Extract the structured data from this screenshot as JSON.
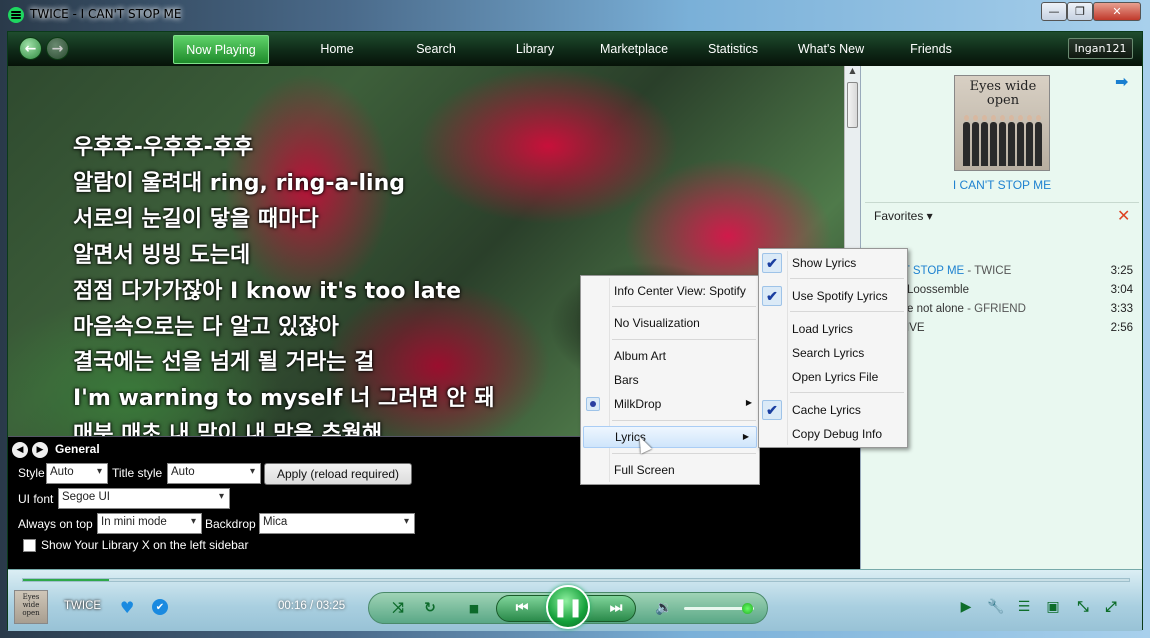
{
  "window": {
    "title": "TWICE - I CAN'T STOP ME",
    "min": "—",
    "max": "❐",
    "close": "✕"
  },
  "nav": {
    "back": "←",
    "forward": "→",
    "tabs": [
      "Now Playing",
      "Home",
      "Search",
      "Library",
      "Marketplace",
      "Statistics",
      "What's New",
      "Friends"
    ],
    "user": "Ingan121"
  },
  "lyrics": [
    "우후후-우후후-후후",
    "알람이 울려대 ring, ring-a-ling",
    "서로의 눈길이 닿을 때마다",
    "알면서 빙빙 도는데",
    "점점 다가가잖아 I know it's too late",
    "마음속으로는 다 알고 있잖아",
    "결국에는 선을 넘게 될 거라는 걸",
    "I'm warning to myself 너 그러면 안 돼",
    "매분 매초 내 맘이 내 맘을 추월해"
  ],
  "right_pane": {
    "album_art_text": "Eyes wide open",
    "next_icon": "➡",
    "track_title": "I CAN'T STOP ME",
    "favorites_label": "Favorites ▾",
    "clear_icon": "✕",
    "favorites": [
      {
        "title": "I CAN'T STOP ME",
        "artist": " - TWICE",
        "duration": "3:25",
        "active": true
      },
      {
        "title": "Loossemble",
        "artist": "",
        "duration": "3:04",
        "active": false
      },
      {
        "title": "e not alone",
        "artist": " - GFRIEND",
        "duration": "3:33",
        "active": false
      },
      {
        "title": "- IVE",
        "artist": "",
        "duration": "2:56",
        "active": false
      }
    ]
  },
  "settings": {
    "prev": "◀",
    "next": "▶",
    "section": "General",
    "style_label": "Style",
    "style_value": "Auto",
    "title_style_label": "Title style",
    "title_style_value": "Auto",
    "apply_label": "Apply (reload required)",
    "ui_font_label": "UI font",
    "ui_font_value": "Segoe UI",
    "always_on_top_label": "Always on top",
    "always_on_top_value": "In mini mode",
    "backdrop_label": "Backdrop",
    "backdrop_value": "Mica",
    "library_checkbox_label": "Show Your Library X on the left sidebar"
  },
  "player": {
    "mini_art_text": "Eyes wide open",
    "artist": "TWICE",
    "heart": "♥",
    "verified": "✔",
    "time": "00:16 / 03:25",
    "progress": 0.078,
    "play_pause": "❚❚",
    "shuffle": "⤨",
    "repeat": "↻",
    "stop": "■",
    "prev": "⏮",
    "next": "⏭",
    "volume_icon": "🔉",
    "volume": 0.85,
    "right_icons": [
      "▶",
      "🔧",
      "☰",
      "▣",
      "⤡",
      "⤢"
    ]
  },
  "menu_main": {
    "items": [
      "Info Center View: Spotify",
      "No Visualization",
      "Album Art",
      "Bars",
      "MilkDrop",
      "Lyrics",
      "Full Screen"
    ]
  },
  "menu_lyrics": {
    "items": [
      "Show Lyrics",
      "Use Spotify Lyrics",
      "Load Lyrics",
      "Search Lyrics",
      "Open Lyrics File",
      "Cache Lyrics",
      "Copy Debug Info"
    ],
    "check": "✔"
  }
}
